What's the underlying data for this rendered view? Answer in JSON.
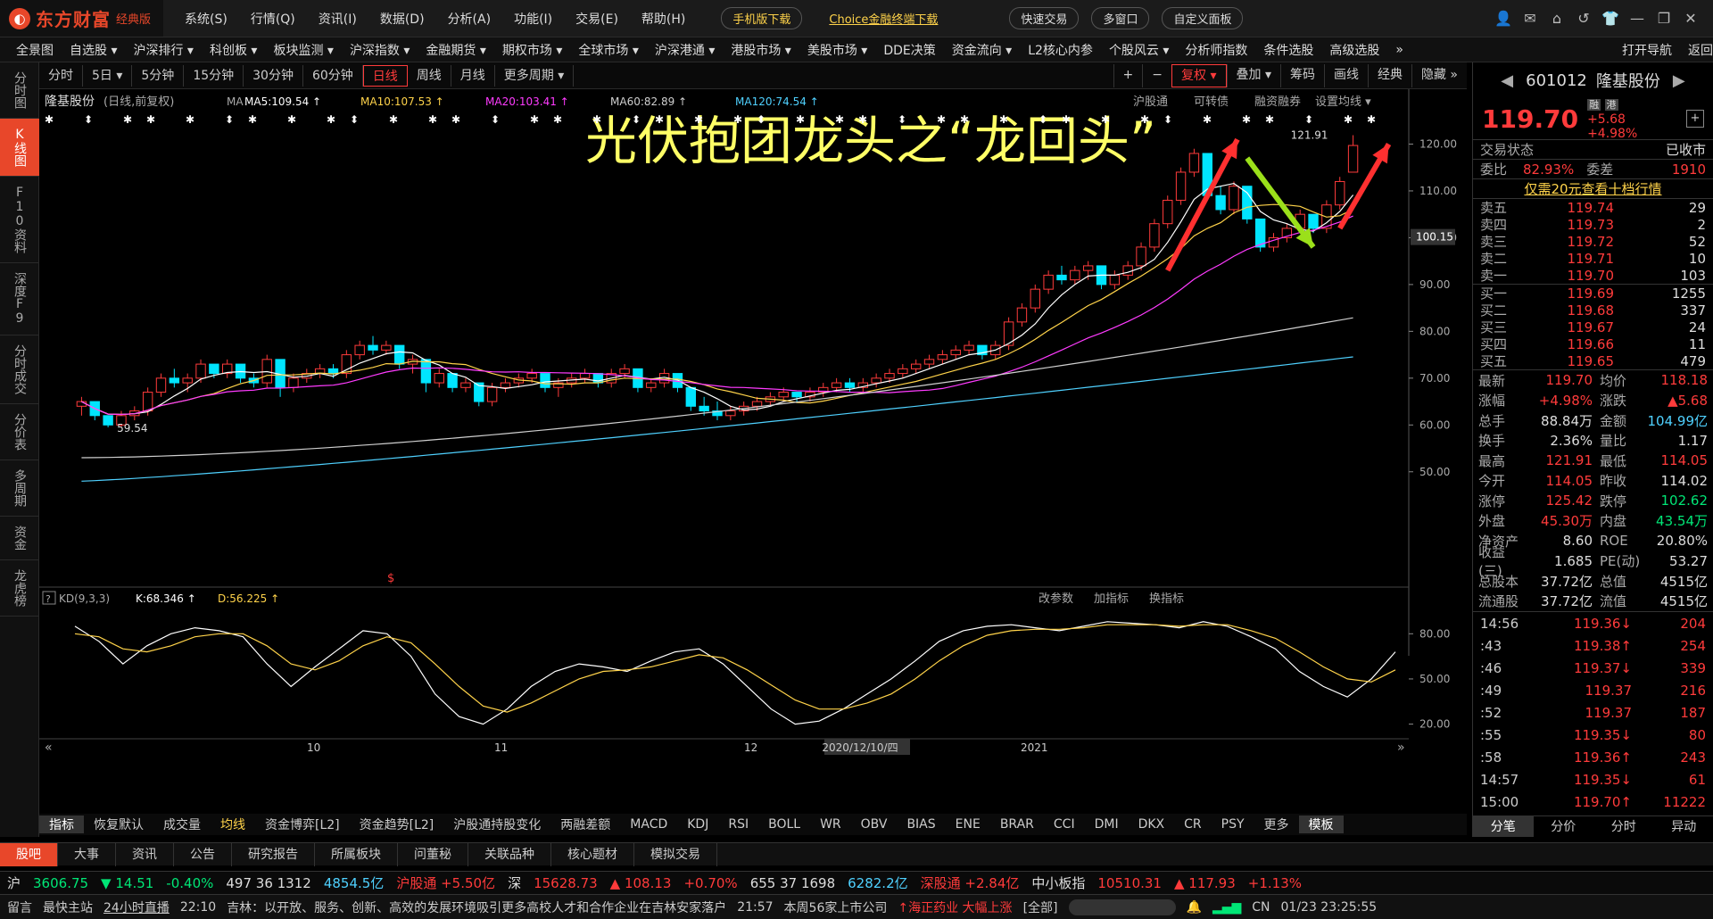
{
  "app": {
    "name": "东方财富",
    "edition": "经典版"
  },
  "menu": [
    "系统(S)",
    "行情(Q)",
    "资讯(I)",
    "数据(D)",
    "分析(A)",
    "功能(I)",
    "交易(E)",
    "帮助(H)"
  ],
  "title_pills": {
    "mobile": "手机版下载",
    "choice": "Choice金融终端下载",
    "quick_trade": "快速交易",
    "multi_window": "多窗口",
    "custom_panel": "自定义面板"
  },
  "nav": [
    "全景图",
    "自选股 ▾",
    "沪深排行 ▾",
    "科创板 ▾",
    "板块监测 ▾",
    "沪深指数 ▾",
    "金融期货 ▾",
    "期权市场 ▾",
    "全球市场 ▾",
    "沪深港通 ▾",
    "港股市场 ▾",
    "美股市场 ▾",
    "DDE决策",
    "资金流向 ▾",
    "L2核心内参",
    "个股风云 ▾",
    "分析师指数",
    "条件选股",
    "高级选股",
    "»"
  ],
  "nav_right": [
    "打开导航",
    "返回"
  ],
  "left_tabs": [
    "分时图",
    "K线图",
    "F10资料",
    "深度F9",
    "分时成交",
    "分价表",
    "多周期",
    "资金",
    "龙虎榜"
  ],
  "periods": [
    "分时",
    "5日 ▾",
    "5分钟",
    "15分钟",
    "30分钟",
    "60分钟",
    "日线",
    "周线",
    "月线",
    "更多周期 ▾"
  ],
  "period_active": "日线",
  "chart_tools": [
    "+",
    "−",
    "复权 ▾",
    "叠加 ▾",
    "筹码",
    "画线",
    "经典",
    "隐藏 »"
  ],
  "chart_header": {
    "stock": "隆基股份",
    "period_note": "(日线,前复权)",
    "ma_label": "MA",
    "ma5": "MA5:109.54 ↑",
    "ma10": "MA10:107.53 ↑",
    "ma20": "MA20:103.41 ↑",
    "ma60": "MA60:82.89 ↑",
    "ma120": "MA120:74.54 ↑",
    "right_links": [
      "沪股通",
      "可转债",
      "融资融券",
      "设置均线 ▾"
    ]
  },
  "annotation_text": "光伏抱团龙头之“龙回头”",
  "price_labels": {
    "high": "121.91",
    "low": "59.54",
    "current_marker": "100.15"
  },
  "x_axis_labels": [
    "10",
    "11",
    "12",
    "2020/12/10/四",
    "2021"
  ],
  "sub_header": {
    "name": "KD(9,3,3)",
    "k": "K:68.346 ↑",
    "d": "D:56.225 ↑",
    "actions": [
      "改参数",
      "加指标",
      "换指标"
    ]
  },
  "chart_data": [
    {
      "type": "candlestick",
      "title": "隆基股份 (日线,前复权)",
      "y_ticks": [
        "120.00",
        "110.00",
        "100.00",
        "90.00",
        "80.00",
        "70.00",
        "60.00",
        "50.00"
      ],
      "ylim": [
        45,
        126
      ],
      "candles": [
        [
          64,
          66,
          62,
          65
        ],
        [
          65,
          64,
          61,
          62
        ],
        [
          62,
          61,
          59.5,
          60
        ],
        [
          60,
          63,
          59.5,
          62
        ],
        [
          62,
          64,
          61,
          63
        ],
        [
          63,
          68,
          62,
          67
        ],
        [
          67,
          71,
          66,
          70
        ],
        [
          70,
          72,
          68,
          69
        ],
        [
          69,
          71,
          67,
          70
        ],
        [
          70,
          74,
          69,
          73
        ],
        [
          73,
          72,
          70,
          71
        ],
        [
          71,
          74,
          70,
          73
        ],
        [
          73,
          72,
          69,
          70
        ],
        [
          70,
          71,
          68,
          69
        ],
        [
          69,
          75,
          68,
          74
        ],
        [
          74,
          71,
          66,
          68
        ],
        [
          68,
          71,
          67,
          70
        ],
        [
          70,
          72,
          69,
          71
        ],
        [
          71,
          73,
          70,
          72
        ],
        [
          72,
          73,
          70,
          71
        ],
        [
          71,
          76,
          70,
          75
        ],
        [
          75,
          78,
          74,
          77
        ],
        [
          77,
          79,
          75,
          76
        ],
        [
          76,
          78,
          75,
          77
        ],
        [
          77,
          76,
          72,
          73
        ],
        [
          73,
          75,
          71,
          74
        ],
        [
          74,
          70,
          67,
          69
        ],
        [
          69,
          72,
          68,
          71
        ],
        [
          71,
          70,
          67,
          68
        ],
        [
          68,
          70,
          67,
          69
        ],
        [
          69,
          67,
          64,
          65
        ],
        [
          65,
          69,
          64,
          68
        ],
        [
          68,
          70,
          67,
          69
        ],
        [
          69,
          71,
          68,
          70
        ],
        [
          70,
          72,
          69,
          71
        ],
        [
          71,
          69,
          67,
          68
        ],
        [
          68,
          70,
          66,
          69
        ],
        [
          69,
          71,
          68,
          70
        ],
        [
          70,
          72,
          69,
          71
        ],
        [
          71,
          71,
          68,
          69
        ],
        [
          69,
          72,
          68,
          71
        ],
        [
          71,
          73,
          70,
          72
        ],
        [
          72,
          70,
          67,
          68
        ],
        [
          68,
          70,
          67,
          69
        ],
        [
          69,
          72,
          68,
          71
        ],
        [
          71,
          70,
          67,
          68
        ],
        [
          68,
          66,
          63,
          64
        ],
        [
          64,
          66,
          62,
          63
        ],
        [
          63,
          65,
          61,
          62
        ],
        [
          62,
          64,
          61,
          63
        ],
        [
          63,
          65,
          62,
          64
        ],
        [
          64,
          66,
          63,
          65
        ],
        [
          65,
          67,
          64,
          66
        ],
        [
          66,
          68,
          65,
          67
        ],
        [
          67,
          67,
          65,
          66
        ],
        [
          66,
          68,
          65,
          67
        ],
        [
          67,
          69,
          66,
          68
        ],
        [
          68,
          70,
          67,
          69
        ],
        [
          69,
          70,
          67,
          68
        ],
        [
          68,
          70,
          67,
          69
        ],
        [
          69,
          71,
          68,
          70
        ],
        [
          70,
          72,
          69,
          71
        ],
        [
          71,
          73,
          70,
          72
        ],
        [
          72,
          74,
          71,
          73
        ],
        [
          73,
          75,
          72,
          74
        ],
        [
          74,
          76,
          73,
          75
        ],
        [
          75,
          77,
          74,
          76
        ],
        [
          76,
          78,
          75,
          77
        ],
        [
          77,
          77,
          74,
          75
        ],
        [
          75,
          78,
          74,
          77
        ],
        [
          77,
          83,
          76,
          82
        ],
        [
          82,
          86,
          81,
          85
        ],
        [
          85,
          90,
          84,
          89
        ],
        [
          89,
          93,
          88,
          92
        ],
        [
          92,
          94,
          90,
          91
        ],
        [
          91,
          94,
          90,
          93
        ],
        [
          93,
          95,
          91,
          94
        ],
        [
          94,
          92,
          89,
          90
        ],
        [
          90,
          93,
          89,
          92
        ],
        [
          92,
          95,
          91,
          94
        ],
        [
          94,
          99,
          93,
          98
        ],
        [
          98,
          104,
          97,
          103
        ],
        [
          103,
          109,
          102,
          108
        ],
        [
          108,
          115,
          107,
          114
        ],
        [
          114,
          119,
          113,
          118
        ],
        [
          118,
          112,
          108,
          109
        ],
        [
          109,
          111,
          105,
          106
        ],
        [
          106,
          112,
          105,
          111
        ],
        [
          111,
          107,
          103,
          104
        ],
        [
          104,
          101,
          97,
          98
        ],
        [
          98,
          101,
          97,
          100
        ],
        [
          100,
          103,
          99,
          102
        ],
        [
          102,
          106,
          101,
          105
        ],
        [
          105,
          104,
          101,
          102
        ],
        [
          102,
          108,
          101,
          107
        ],
        [
          107,
          113,
          106,
          112
        ],
        [
          114,
          121.9,
          114,
          119.7
        ]
      ],
      "ma_series": {
        "MA5": "white",
        "MA10": "yellow",
        "MA20": "magenta",
        "MA60": "lightgray",
        "MA120": "cyan"
      },
      "ma_end_values": {
        "MA5": 109.54,
        "MA10": 107.53,
        "MA20": 103.41,
        "MA60": 82.89,
        "MA120": 74.54
      }
    },
    {
      "type": "line",
      "title": "KD(9,3,3)",
      "y_ticks": [
        "80.00",
        "50.00",
        "20.00"
      ],
      "ylim": [
        15,
        95
      ],
      "series": [
        {
          "name": "K",
          "color": "#ffffff",
          "values": [
            85,
            75,
            60,
            72,
            80,
            84,
            82,
            78,
            60,
            45,
            58,
            70,
            82,
            80,
            65,
            40,
            25,
            20,
            30,
            45,
            55,
            60,
            58,
            55,
            62,
            68,
            70,
            60,
            45,
            30,
            20,
            22,
            30,
            40,
            50,
            62,
            75,
            82,
            85,
            86,
            84,
            82,
            85,
            88,
            87,
            86,
            84,
            88,
            85,
            78,
            70,
            55,
            45,
            38,
            50,
            68
          ]
        },
        {
          "name": "D",
          "color": "#ffd34a",
          "values": [
            80,
            78,
            70,
            68,
            72,
            78,
            80,
            80,
            72,
            60,
            56,
            62,
            72,
            78,
            74,
            60,
            45,
            32,
            28,
            34,
            42,
            50,
            55,
            56,
            58,
            62,
            66,
            64,
            56,
            46,
            36,
            30,
            30,
            34,
            40,
            50,
            62,
            72,
            79,
            82,
            83,
            83,
            84,
            86,
            86,
            86,
            85,
            86,
            86,
            82,
            77,
            68,
            58,
            50,
            48,
            56
          ]
        }
      ]
    }
  ],
  "right_panel": {
    "code": "601012",
    "name": "隆基股份",
    "tags": [
      "融",
      "港"
    ],
    "price": "119.70",
    "change": "+5.68",
    "pct": "+4.98%",
    "status_label": "交易状态",
    "status_value": "已收市",
    "weibi_label": "委比",
    "weibi": "82.93%",
    "weicha_label": "委差",
    "weicha": "1910",
    "promo": "仅需20元查看十档行情",
    "sell": [
      [
        "卖五",
        "119.74",
        "29"
      ],
      [
        "卖四",
        "119.73",
        "2"
      ],
      [
        "卖三",
        "119.72",
        "52"
      ],
      [
        "卖二",
        "119.71",
        "10"
      ],
      [
        "卖一",
        "119.70",
        "103"
      ]
    ],
    "buy": [
      [
        "买一",
        "119.69",
        "1255"
      ],
      [
        "买二",
        "119.68",
        "337"
      ],
      [
        "买三",
        "119.67",
        "24"
      ],
      [
        "买四",
        "119.66",
        "11"
      ],
      [
        "买五",
        "119.65",
        "479"
      ]
    ],
    "stats": [
      [
        "最新",
        "119.70",
        "均价",
        "118.18"
      ],
      [
        "涨幅",
        "+4.98%",
        "涨跌",
        "▲5.68"
      ],
      [
        "总手",
        "88.84万",
        "金额",
        "104.99亿"
      ],
      [
        "换手",
        "2.36%",
        "量比",
        "1.17"
      ],
      [
        "最高",
        "121.91",
        "最低",
        "114.05"
      ],
      [
        "今开",
        "114.05",
        "昨收",
        "114.02"
      ],
      [
        "涨停",
        "125.42",
        "跌停",
        "102.62"
      ],
      [
        "外盘",
        "45.30万",
        "内盘",
        "43.54万"
      ],
      [
        "净资产",
        "8.60",
        "ROE",
        "20.80%"
      ],
      [
        "收益(三)",
        "1.685",
        "PE(动)",
        "53.27"
      ],
      [
        "总股本",
        "37.72亿",
        "总值",
        "4515亿"
      ],
      [
        "流通股",
        "37.72亿",
        "流值",
        "4515亿"
      ]
    ],
    "ticks": [
      [
        "14:56",
        "119.36↓",
        "204"
      ],
      [
        ":43",
        "119.38↑",
        "254"
      ],
      [
        ":46",
        "119.37↓",
        "339"
      ],
      [
        ":49",
        "119.37",
        "216"
      ],
      [
        ":52",
        "119.37",
        "187"
      ],
      [
        ":55",
        "119.35↓",
        "80"
      ],
      [
        ":58",
        "119.36↑",
        "243"
      ],
      [
        "14:57",
        "119.35↓",
        "61"
      ],
      [
        "15:00",
        "119.70↑",
        "11222"
      ]
    ],
    "bottom_tabs": [
      "分笔",
      "分价",
      "分时",
      "异动"
    ]
  },
  "indicator_tabs": [
    "指标",
    "恢复默认",
    "成交量",
    "均线",
    "资金博弈[L2]",
    "资金趋势[L2]",
    "沪股通持股变化",
    "两融差额",
    "MACD",
    "KDJ",
    "RSI",
    "BOLL",
    "WR",
    "OBV",
    "BIAS",
    "ENE",
    "BRAR",
    "CCI",
    "DMI",
    "DKX",
    "CR",
    "PSY",
    "更多",
    "模板"
  ],
  "bottom_tabs": [
    "股吧",
    "大事",
    "资讯",
    "公告",
    "研究报告",
    "所属板块",
    "问董秘",
    "关联品种",
    "核心题材",
    "模拟交易"
  ],
  "index_bar": {
    "sh_label": "沪",
    "sh": "3606.75",
    "sh_chg": "▼ 14.51",
    "sh_pct": "-0.40%",
    "sh_counts": "497 36 1312",
    "sh_amt": "4854.5亿",
    "hgt": "沪股通 +5.50亿",
    "sz_label": "深",
    "sz": "15628.73",
    "sz_chg": "▲ 108.13",
    "sz_pct": "+0.70%",
    "sz_counts": "655 37 1698",
    "sz_amt": "6282.2亿",
    "sgt": "深股通 +2.84亿",
    "zxb_label": "中小板指",
    "zxb": "10510.31",
    "zxb_chg": "▲ 117.93",
    "zxb_pct": "+1.13%"
  },
  "status_bar": {
    "left1": "留言",
    "left2": "最快主站",
    "live": "24小时直播",
    "time1": "22:10",
    "news1": "吉林：以开放、服务、创新、高效的发展环境吸引更多高校人才和合作企业在吉林安家落户",
    "time2": "21:57",
    "news2": "本周56家上市公司",
    "alert": "↑海正药业 大幅上涨",
    "all": "[全部]",
    "cn": "CN",
    "datetime": "01/23 23:25:55"
  }
}
